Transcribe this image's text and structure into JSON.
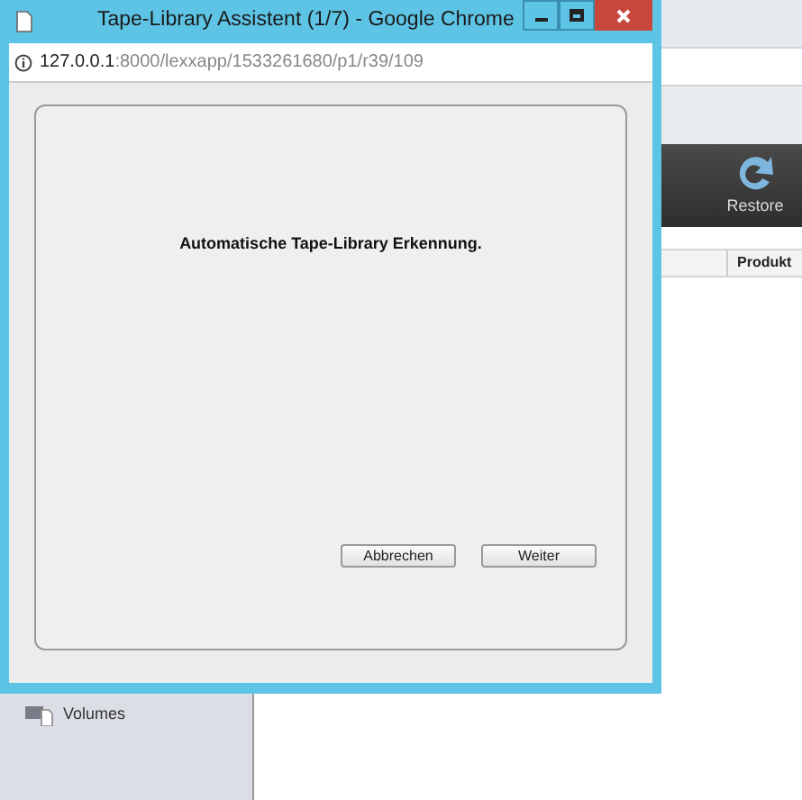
{
  "popup": {
    "title": "Tape-Library Assistent (1/7) - Google Chrome",
    "address": {
      "host": "127.0.0.1",
      "path": ":8000/lexxapp/1533261680/p1/r39/109"
    },
    "heading": "Automatische Tape-Library Erkennung.",
    "buttons": [
      "Abbrechen",
      "Weiter"
    ]
  },
  "toolbar": {
    "buttons": [
      {
        "label": "Restore"
      }
    ]
  },
  "table": {
    "columns": [
      "Produkt"
    ]
  },
  "sidebar": {
    "items": [
      {
        "label": "Volumes"
      }
    ]
  }
}
